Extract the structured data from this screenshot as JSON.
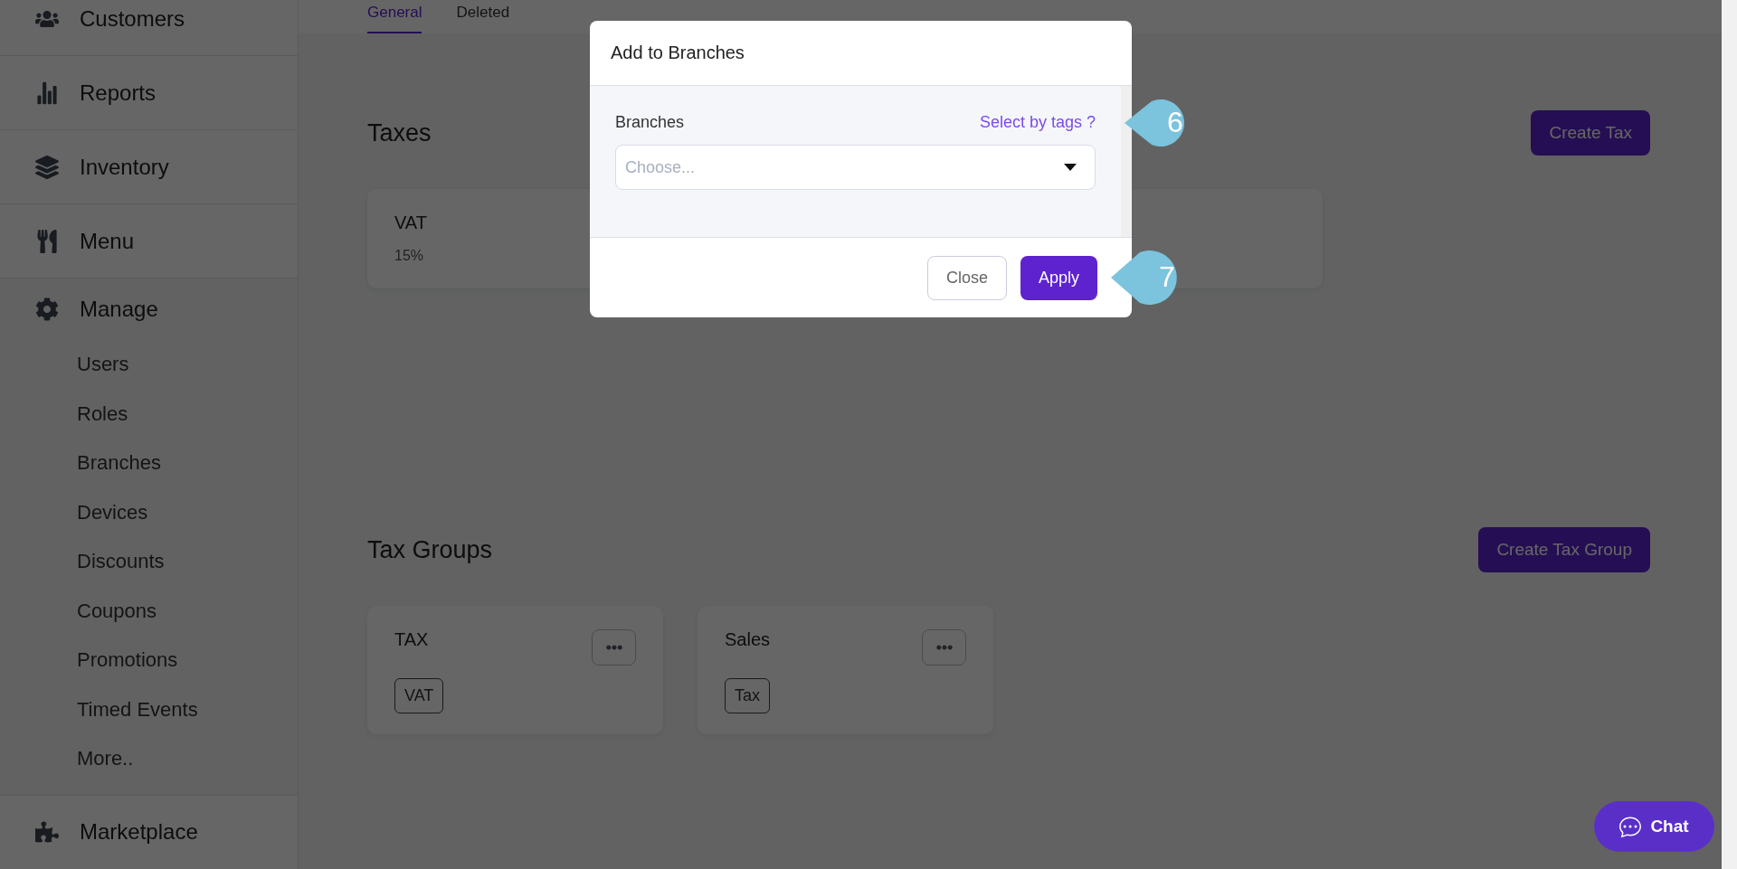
{
  "sidebar": {
    "items": [
      {
        "label": "Customers"
      },
      {
        "label": "Reports"
      },
      {
        "label": "Inventory"
      },
      {
        "label": "Menu"
      },
      {
        "label": "Manage",
        "children": [
          {
            "label": "Users"
          },
          {
            "label": "Roles"
          },
          {
            "label": "Branches"
          },
          {
            "label": "Devices"
          },
          {
            "label": "Discounts"
          },
          {
            "label": "Coupons"
          },
          {
            "label": "Promotions"
          },
          {
            "label": "Timed Events"
          },
          {
            "label": "More.."
          }
        ]
      },
      {
        "label": "Marketplace"
      }
    ]
  },
  "tabs": [
    {
      "label": "General",
      "selected": true
    },
    {
      "label": "Deleted",
      "selected": false
    }
  ],
  "taxes": {
    "title": "Taxes",
    "button": "Create Tax",
    "cards": [
      {
        "name": "VAT",
        "rate": "15%"
      }
    ]
  },
  "tax_groups": {
    "title": "Tax Groups",
    "button": "Create Tax Group",
    "cards": [
      {
        "name": "TAX",
        "tags": [
          "VAT"
        ]
      },
      {
        "name": "Sales",
        "tags": [
          "Tax"
        ]
      }
    ]
  },
  "modal": {
    "title": "Add to Branches",
    "field_label": "Branches",
    "link": "Select by tags ?",
    "select": {
      "placeholder": "Choose..."
    },
    "buttons": [
      {
        "label": "Close",
        "kind": "secondary"
      },
      {
        "label": "Apply",
        "kind": "primary"
      }
    ]
  },
  "callouts": [
    {
      "label": "6"
    },
    {
      "label": "7"
    }
  ],
  "chat": {
    "label": "Chat"
  }
}
